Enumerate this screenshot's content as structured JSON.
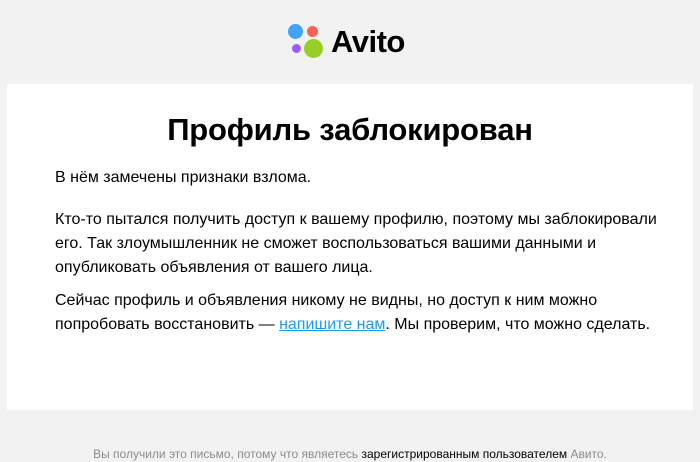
{
  "colors": {
    "page_bg": "#f2f2f2",
    "card_bg": "#ffffff",
    "link": "#1a9bef",
    "muted": "#8c8c8c",
    "logo_blue": "#3fa2fb",
    "logo_red": "#fc6156",
    "logo_purple": "#9b5cf6",
    "logo_green": "#97cf26"
  },
  "header": {
    "logo_text": "Avito"
  },
  "card": {
    "title": "Профиль заблокирован",
    "p1": "В нём замечены признаки взлома.",
    "p2": "Кто-то пытался получить доступ к вашему профилю, поэтому мы заблокировали его. Так злоумышленник не сможет воспользоваться вашими данными и опубликовать объявления от вашего лица.",
    "p3_before": "Сейчас профиль и объявления никому не видны, но доступ к ним можно попробовать восстановить — ",
    "p3_link": "напишите нам",
    "p3_after": ". Мы проверим, что можно сделать."
  },
  "footer": {
    "before": "Вы получили это письмо, потому что являетесь ",
    "highlight": "зарегистрированным пользователем",
    "after": " Авито."
  }
}
